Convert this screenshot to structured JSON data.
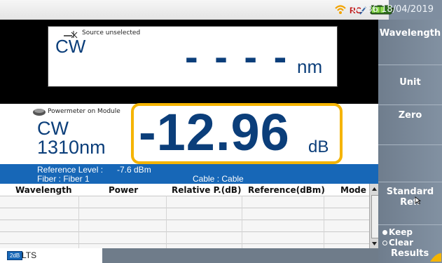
{
  "status_bar": {
    "time": "02:36 18/04/2019",
    "icons": [
      "wifi-icon",
      "remote-control-icon",
      "battery-icon"
    ]
  },
  "source": {
    "status": "Source unselected",
    "mode": "CW",
    "value": "- - - -",
    "unit": "nm"
  },
  "powermeter": {
    "label": "Powermeter on Module",
    "mode": "CW",
    "wavelength": "1310nm",
    "reading": "-12.96",
    "unit": "dB"
  },
  "reference": {
    "level_label": "Reference Level :",
    "level_value": "-7.6 dBm",
    "fiber": "Fiber : Fiber  1",
    "cable": "Cable : Cable"
  },
  "table": {
    "headers": [
      "Wavelength",
      "Power",
      "Relative P.(dB)",
      "Reference(dBm)",
      "Mode"
    ],
    "rows": 4
  },
  "menu": {
    "wavelength": "Wavelength",
    "unit": "Unit",
    "zero": "Zero",
    "standard_ref_line1": "Standard",
    "standard_ref_line2": "Ref.",
    "keep": "Keep",
    "clear": "Clear",
    "results": "Results"
  },
  "footer": {
    "badge": "2dB",
    "label": "LTS"
  },
  "colors": {
    "highlight_border": "#f5b400",
    "ref_bar": "#1767b7",
    "menu_bg": "#7b8a9b"
  }
}
